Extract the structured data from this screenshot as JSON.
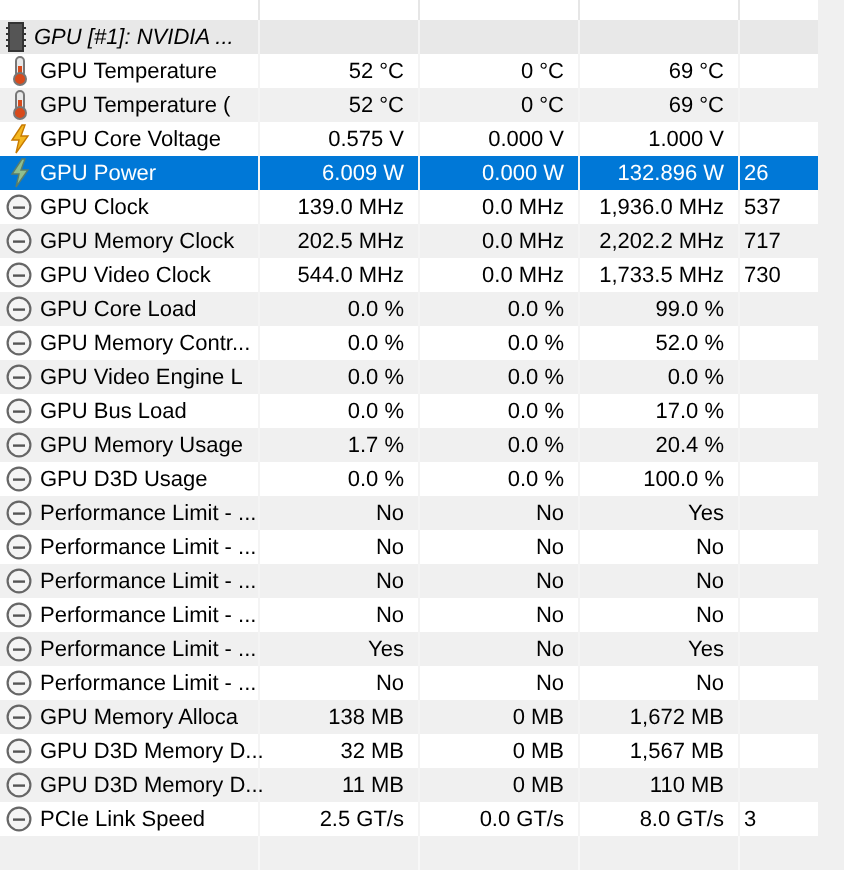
{
  "group": {
    "title": "GPU [#1]: NVIDIA ..."
  },
  "rows": [
    {
      "kind": "thermometer",
      "name": "GPU Temperature",
      "column_1": "52 °C",
      "column_2": "0 °C",
      "column_3": "69 °C",
      "selected": false
    },
    {
      "kind": "thermometer",
      "name": "GPU Temperature (",
      "column_1": "52 °C",
      "column_2": "0 °C",
      "column_3": "69 °C",
      "selected": false
    },
    {
      "kind": "voltage",
      "name": "GPU Core Voltage",
      "column_1": "0.575 V",
      "column_2": "0.000 V",
      "column_3": "1.000 V",
      "selected": false
    },
    {
      "kind": "power",
      "name": "GPU Power",
      "column_1": "6.009 W",
      "column_2": "0.000 W",
      "column_3": "132.896 W",
      "column_4": "26",
      "selected": true
    },
    {
      "kind": "clock",
      "name": "GPU Clock",
      "column_1": "139.0 MHz",
      "column_2": "0.0 MHz",
      "column_3": "1,936.0 MHz",
      "column_4": "537",
      "selected": false
    },
    {
      "kind": "clock",
      "name": "GPU Memory Clock",
      "column_1": "202.5 MHz",
      "column_2": "0.0 MHz",
      "column_3": "2,202.2 MHz",
      "column_4": "717",
      "selected": false
    },
    {
      "kind": "clock",
      "name": "GPU Video Clock",
      "column_1": "544.0 MHz",
      "column_2": "0.0 MHz",
      "column_3": "1,733.5 MHz",
      "column_4": "730",
      "selected": false
    },
    {
      "kind": "clock",
      "name": "GPU Core Load",
      "column_1": "0.0 %",
      "column_2": "0.0 %",
      "column_3": "99.0 %",
      "selected": false
    },
    {
      "kind": "clock",
      "name": "GPU Memory Contr...",
      "column_1": "0.0 %",
      "column_2": "0.0 %",
      "column_3": "52.0 %",
      "selected": false
    },
    {
      "kind": "clock",
      "name": "GPU Video Engine L",
      "column_1": "0.0 %",
      "column_2": "0.0 %",
      "column_3": "0.0 %",
      "selected": false
    },
    {
      "kind": "clock",
      "name": "GPU Bus Load",
      "column_1": "0.0 %",
      "column_2": "0.0 %",
      "column_3": "17.0 %",
      "selected": false
    },
    {
      "kind": "clock",
      "name": "GPU Memory Usage",
      "column_1": "1.7 %",
      "column_2": "0.0 %",
      "column_3": "20.4 %",
      "selected": false
    },
    {
      "kind": "clock",
      "name": "GPU D3D Usage",
      "column_1": "0.0 %",
      "column_2": "0.0 %",
      "column_3": "100.0 %",
      "selected": false
    },
    {
      "kind": "clock",
      "name": "Performance Limit - ...",
      "column_1": "No",
      "column_2": "No",
      "column_3": "Yes",
      "selected": false
    },
    {
      "kind": "clock",
      "name": "Performance Limit - ...",
      "column_1": "No",
      "column_2": "No",
      "column_3": "No",
      "selected": false
    },
    {
      "kind": "clock",
      "name": "Performance Limit - ...",
      "column_1": "No",
      "column_2": "No",
      "column_3": "No",
      "selected": false
    },
    {
      "kind": "clock",
      "name": "Performance Limit - ...",
      "column_1": "No",
      "column_2": "No",
      "column_3": "No",
      "selected": false
    },
    {
      "kind": "clock",
      "name": "Performance Limit - ...",
      "column_1": "Yes",
      "column_2": "No",
      "column_3": "Yes",
      "selected": false
    },
    {
      "kind": "clock",
      "name": "Performance Limit - ...",
      "column_1": "No",
      "column_2": "No",
      "column_3": "No",
      "selected": false
    },
    {
      "kind": "clock",
      "name": "GPU Memory Alloca",
      "column_1": "138 MB",
      "column_2": "0 MB",
      "column_3": "1,672 MB",
      "selected": false
    },
    {
      "kind": "clock",
      "name": "GPU D3D Memory D...",
      "column_1": "32 MB",
      "column_2": "0 MB",
      "column_3": "1,567 MB",
      "selected": false
    },
    {
      "kind": "clock",
      "name": "GPU D3D Memory D...",
      "column_1": "11 MB",
      "column_2": "0 MB",
      "column_3": "110 MB",
      "selected": false
    },
    {
      "kind": "clock",
      "name": "PCIe Link Speed",
      "column_1": "2.5 GT/s",
      "column_2": "0.0 GT/s",
      "column_3": "8.0 GT/s",
      "column_4": "3",
      "selected": false
    }
  ]
}
